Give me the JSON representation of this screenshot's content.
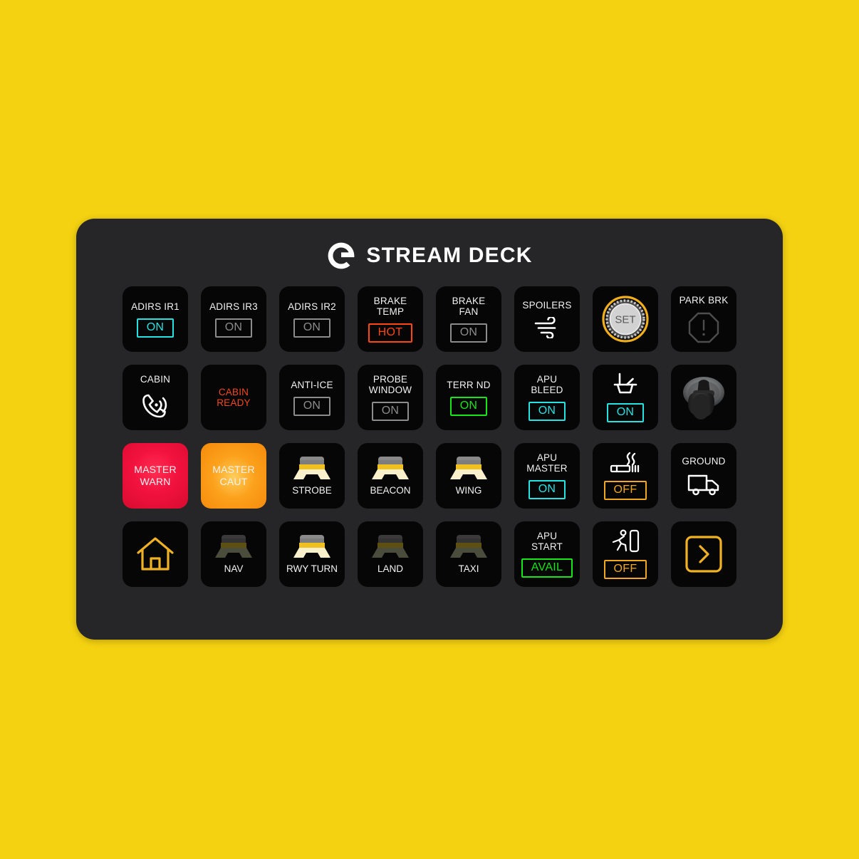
{
  "background_color": "#F5D211",
  "deck": {
    "body_color": "#262628",
    "key_color": "#060606",
    "brand_name": "STREAM DECK",
    "logo_icon": "elgato-logo-icon"
  },
  "colors": {
    "cyan": "#25E3E3",
    "grey": "#8c8c8c",
    "red": "#FF4713",
    "green": "#19E619",
    "amber": "#F0A81E",
    "warn_red": "#F3123F",
    "caut_orange": "#FCA11C",
    "white": "#f2f2f2"
  },
  "keys": [
    {
      "name": "adirs-ir1",
      "title": "ADIRS IR1",
      "badge": "ON",
      "badge_state": "cyan"
    },
    {
      "name": "adirs-ir3",
      "title": "ADIRS IR3",
      "badge": "ON",
      "badge_state": "grey"
    },
    {
      "name": "adirs-ir2",
      "title": "ADIRS IR2",
      "badge": "ON",
      "badge_state": "grey"
    },
    {
      "name": "brake-temp",
      "title": "BRAKE\nTEMP",
      "badge": "HOT",
      "badge_state": "red"
    },
    {
      "name": "brake-fan",
      "title": "BRAKE\nFAN",
      "badge": "ON",
      "badge_state": "grey"
    },
    {
      "name": "spoilers",
      "title": "SPOILERS",
      "icon": "wind-icon"
    },
    {
      "name": "set-knob",
      "title": "",
      "icon": "set-knob-icon",
      "knob_label": "SET"
    },
    {
      "name": "park-brk",
      "title": "PARK BRK",
      "icon": "octagon-warning-icon"
    },
    {
      "name": "cabin-call",
      "title": "CABIN",
      "icon": "phone-call-icon"
    },
    {
      "name": "cabin-ready",
      "title": "CABIN\nREADY",
      "title_state": "red"
    },
    {
      "name": "anti-ice",
      "title": "ANTI-ICE",
      "badge": "ON",
      "badge_state": "grey"
    },
    {
      "name": "probe-window",
      "title": "PROBE\nWINDOW",
      "badge": "ON",
      "badge_state": "grey"
    },
    {
      "name": "terr-nd",
      "title": "TERR ND",
      "badge": "ON",
      "badge_state": "green"
    },
    {
      "name": "apu-bleed",
      "title": "APU\nBLEED",
      "badge": "ON",
      "badge_state": "cyan"
    },
    {
      "name": "seatbelt-sign",
      "title": "",
      "icon": "seatbelt-icon",
      "badge": "ON",
      "badge_state": "cyan"
    },
    {
      "name": "headset",
      "title": "",
      "icon": "headset-photo-icon"
    },
    {
      "name": "master-warn",
      "title": "MASTER\nWARN",
      "style": "master-warn"
    },
    {
      "name": "master-caut",
      "title": "MASTER\nCAUT",
      "style": "master-caut"
    },
    {
      "name": "strobe-light",
      "caption": "STROBE",
      "icon": "lamp-icon",
      "lamp_state": "on"
    },
    {
      "name": "beacon-light",
      "caption": "BEACON",
      "icon": "lamp-icon",
      "lamp_state": "on"
    },
    {
      "name": "wing-light",
      "caption": "WING",
      "icon": "lamp-icon",
      "lamp_state": "on"
    },
    {
      "name": "apu-master",
      "title": "APU\nMASTER",
      "badge": "ON",
      "badge_state": "cyan"
    },
    {
      "name": "no-smoking",
      "title": "",
      "icon": "cigarette-icon",
      "badge": "OFF",
      "badge_state": "amber"
    },
    {
      "name": "ground",
      "title": "GROUND",
      "icon": "truck-icon"
    },
    {
      "name": "home",
      "title": "",
      "icon": "home-icon"
    },
    {
      "name": "nav-light",
      "caption": "NAV",
      "icon": "lamp-icon",
      "lamp_state": "off"
    },
    {
      "name": "rwy-turn-light",
      "caption": "RWY TURN",
      "icon": "lamp-icon",
      "lamp_state": "on"
    },
    {
      "name": "land-light",
      "caption": "LAND",
      "icon": "lamp-icon",
      "lamp_state": "off"
    },
    {
      "name": "taxi-light",
      "caption": "TAXI",
      "icon": "lamp-icon",
      "lamp_state": "off"
    },
    {
      "name": "apu-start",
      "title": "APU\nSTART",
      "badge": "AVAIL",
      "badge_state": "green"
    },
    {
      "name": "evacuation",
      "title": "",
      "icon": "exit-run-icon",
      "badge": "OFF",
      "badge_state": "amber"
    },
    {
      "name": "next-page",
      "title": "",
      "icon": "chevron-right-boxed-icon"
    }
  ]
}
